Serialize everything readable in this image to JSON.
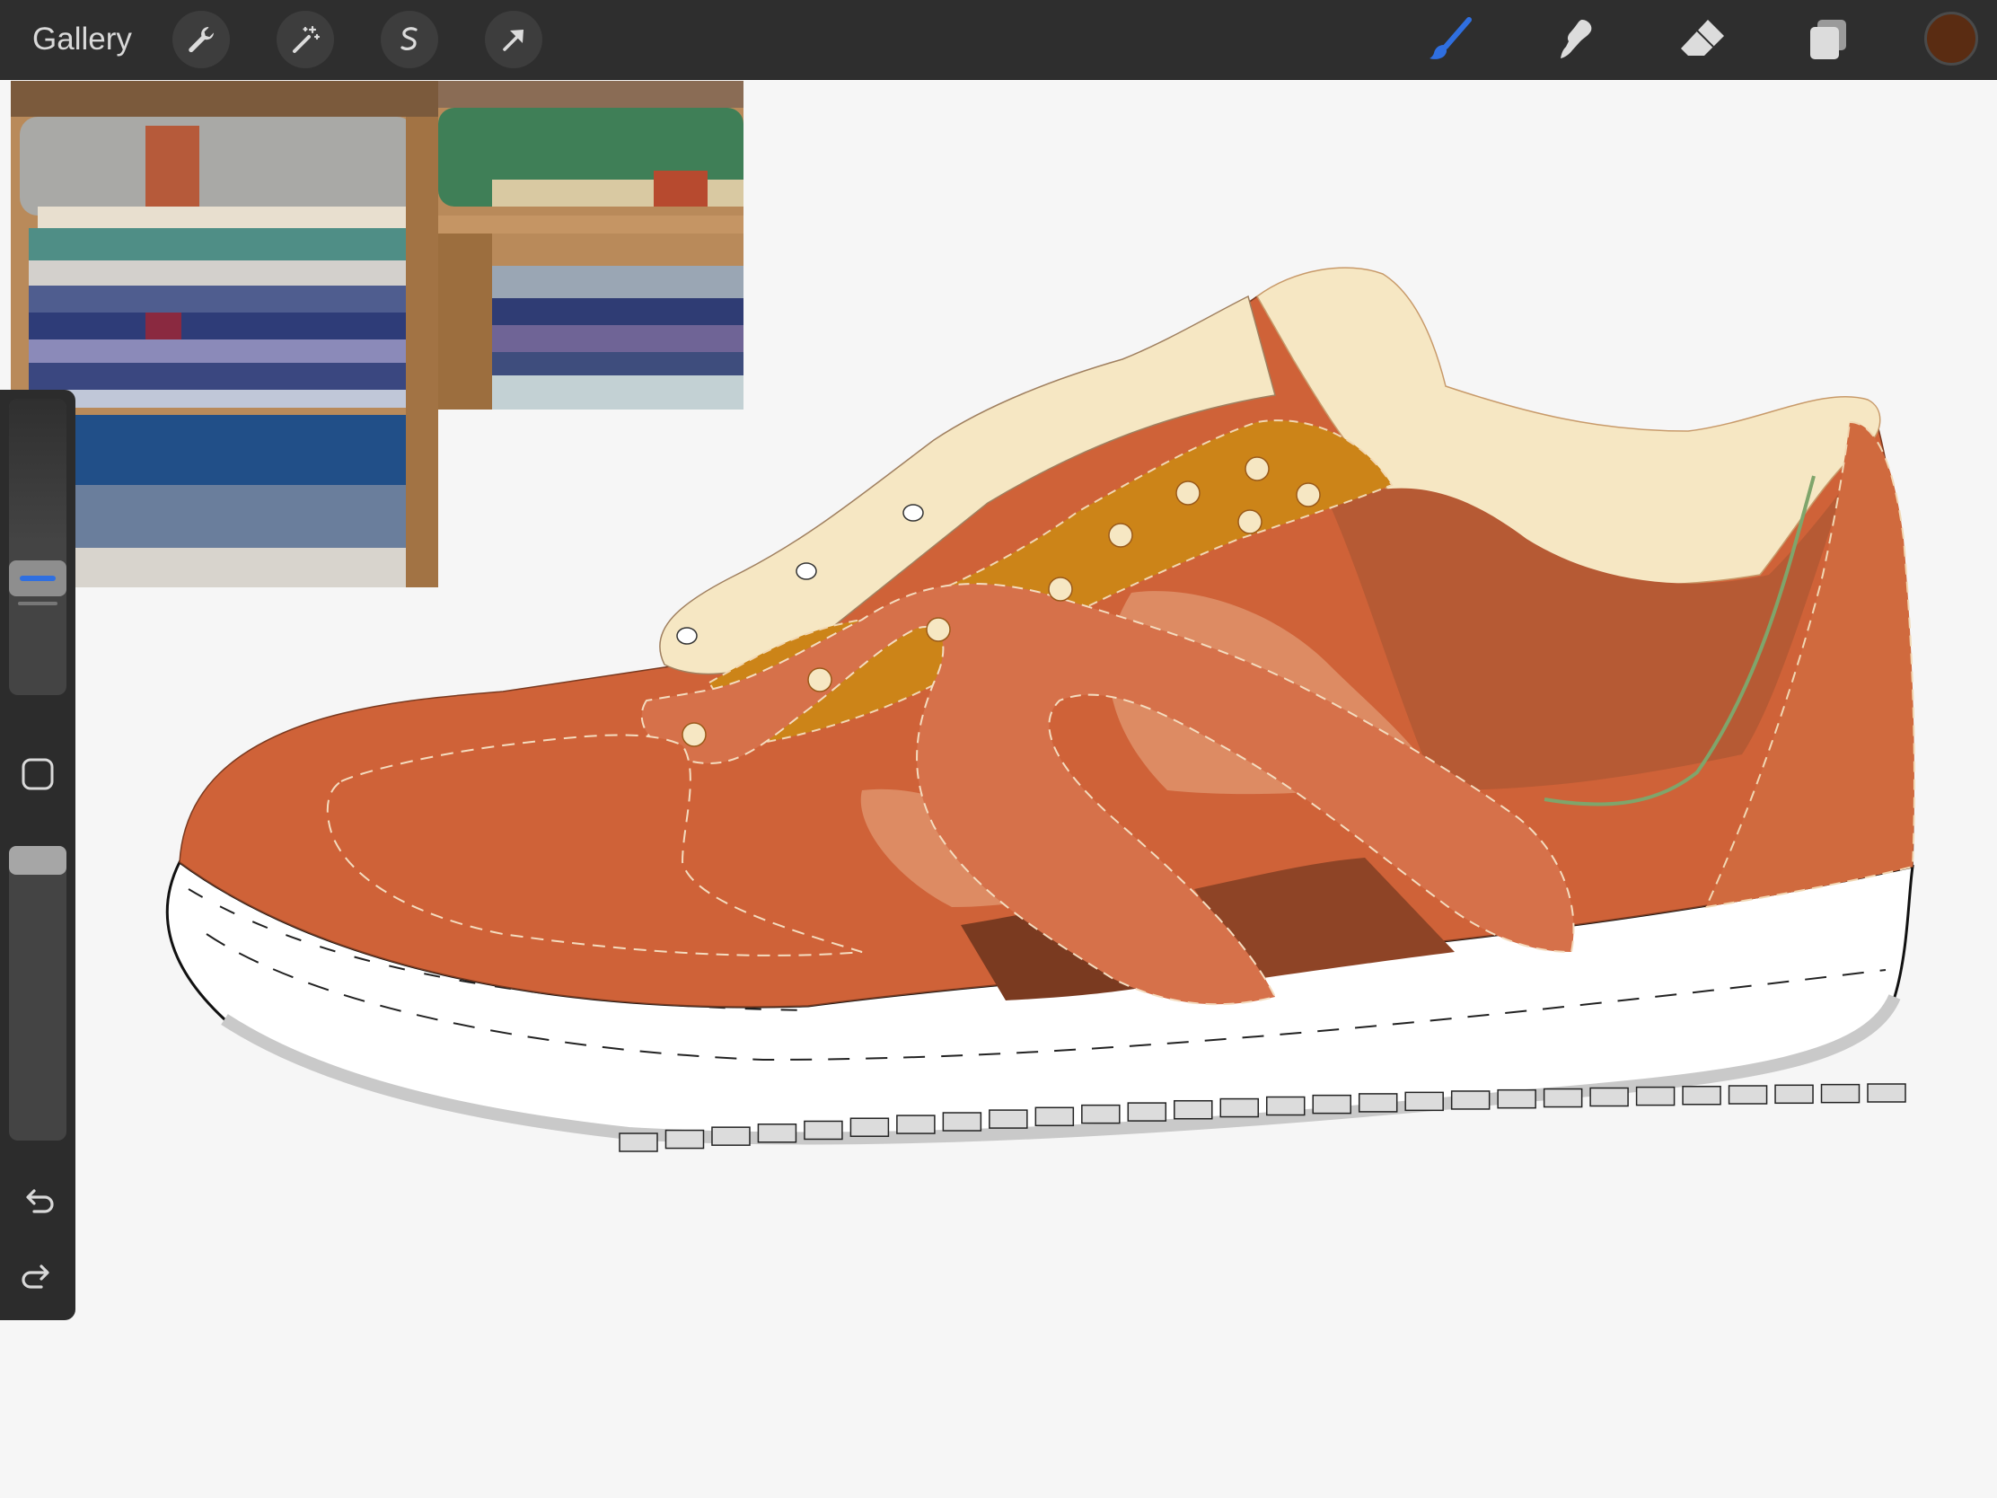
{
  "toolbar": {
    "gallery_label": "Gallery",
    "left_tools": [
      "wrench-icon",
      "magic-wand-icon",
      "selection-icon",
      "transform-arrow-icon"
    ],
    "right_tools": [
      "brush-icon",
      "smudge-icon",
      "eraser-icon",
      "layers-icon"
    ],
    "active_tool": "brush",
    "active_color": "#5a2c12",
    "accent": "#2f6fe0"
  },
  "sidebar": {
    "controls": [
      "brush-size-slider",
      "modify-button",
      "opacity-slider",
      "undo-icon",
      "redo-icon"
    ],
    "brush_size": 0.38,
    "opacity": 1.0
  },
  "canvas": {
    "subject": "sneaker-drawing",
    "palette": {
      "upper": "#cf6238",
      "overlay": "#d6714a",
      "panel_light": "#dd8b63",
      "inner": "#b65a34",
      "eyestay": "#cc8418",
      "collar": "#f6e7c3",
      "stripe_dark": "#7a3a20",
      "stripe_mid": "#8e4426",
      "sole": "#ffffff"
    }
  }
}
